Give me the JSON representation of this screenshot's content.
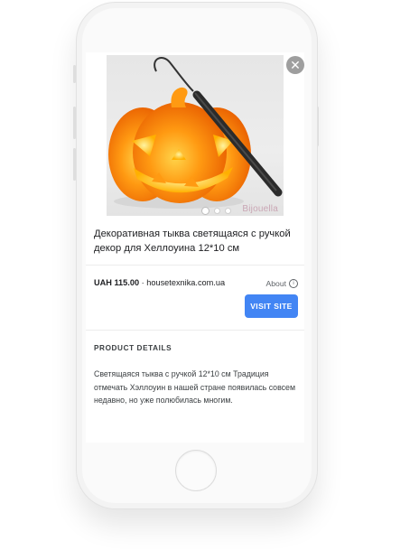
{
  "product": {
    "title": "Декоративная тыква светящаяся с ручкой декор для Хеллоуина 12*10 см",
    "price": "UAH 115.00",
    "separator": "·",
    "site": "housetexnika.com.ua",
    "about_label": "About",
    "visit_label": "VISIT SITE",
    "image_watermark": "Bijouella",
    "carousel": {
      "count": 3,
      "active_index": 0
    }
  },
  "details": {
    "heading": "PRODUCT DETAILS",
    "text": "Светящаяся тыква с ручкой 12*10 см Традиция отмечать Хэллоуин в нашей стране появилась совсем недавно, но уже полюбилась многим."
  },
  "icons": {
    "close": "close-icon",
    "info": "info-icon"
  },
  "colors": {
    "accent": "#4285f4",
    "pumpkin": "#ff8a00"
  }
}
